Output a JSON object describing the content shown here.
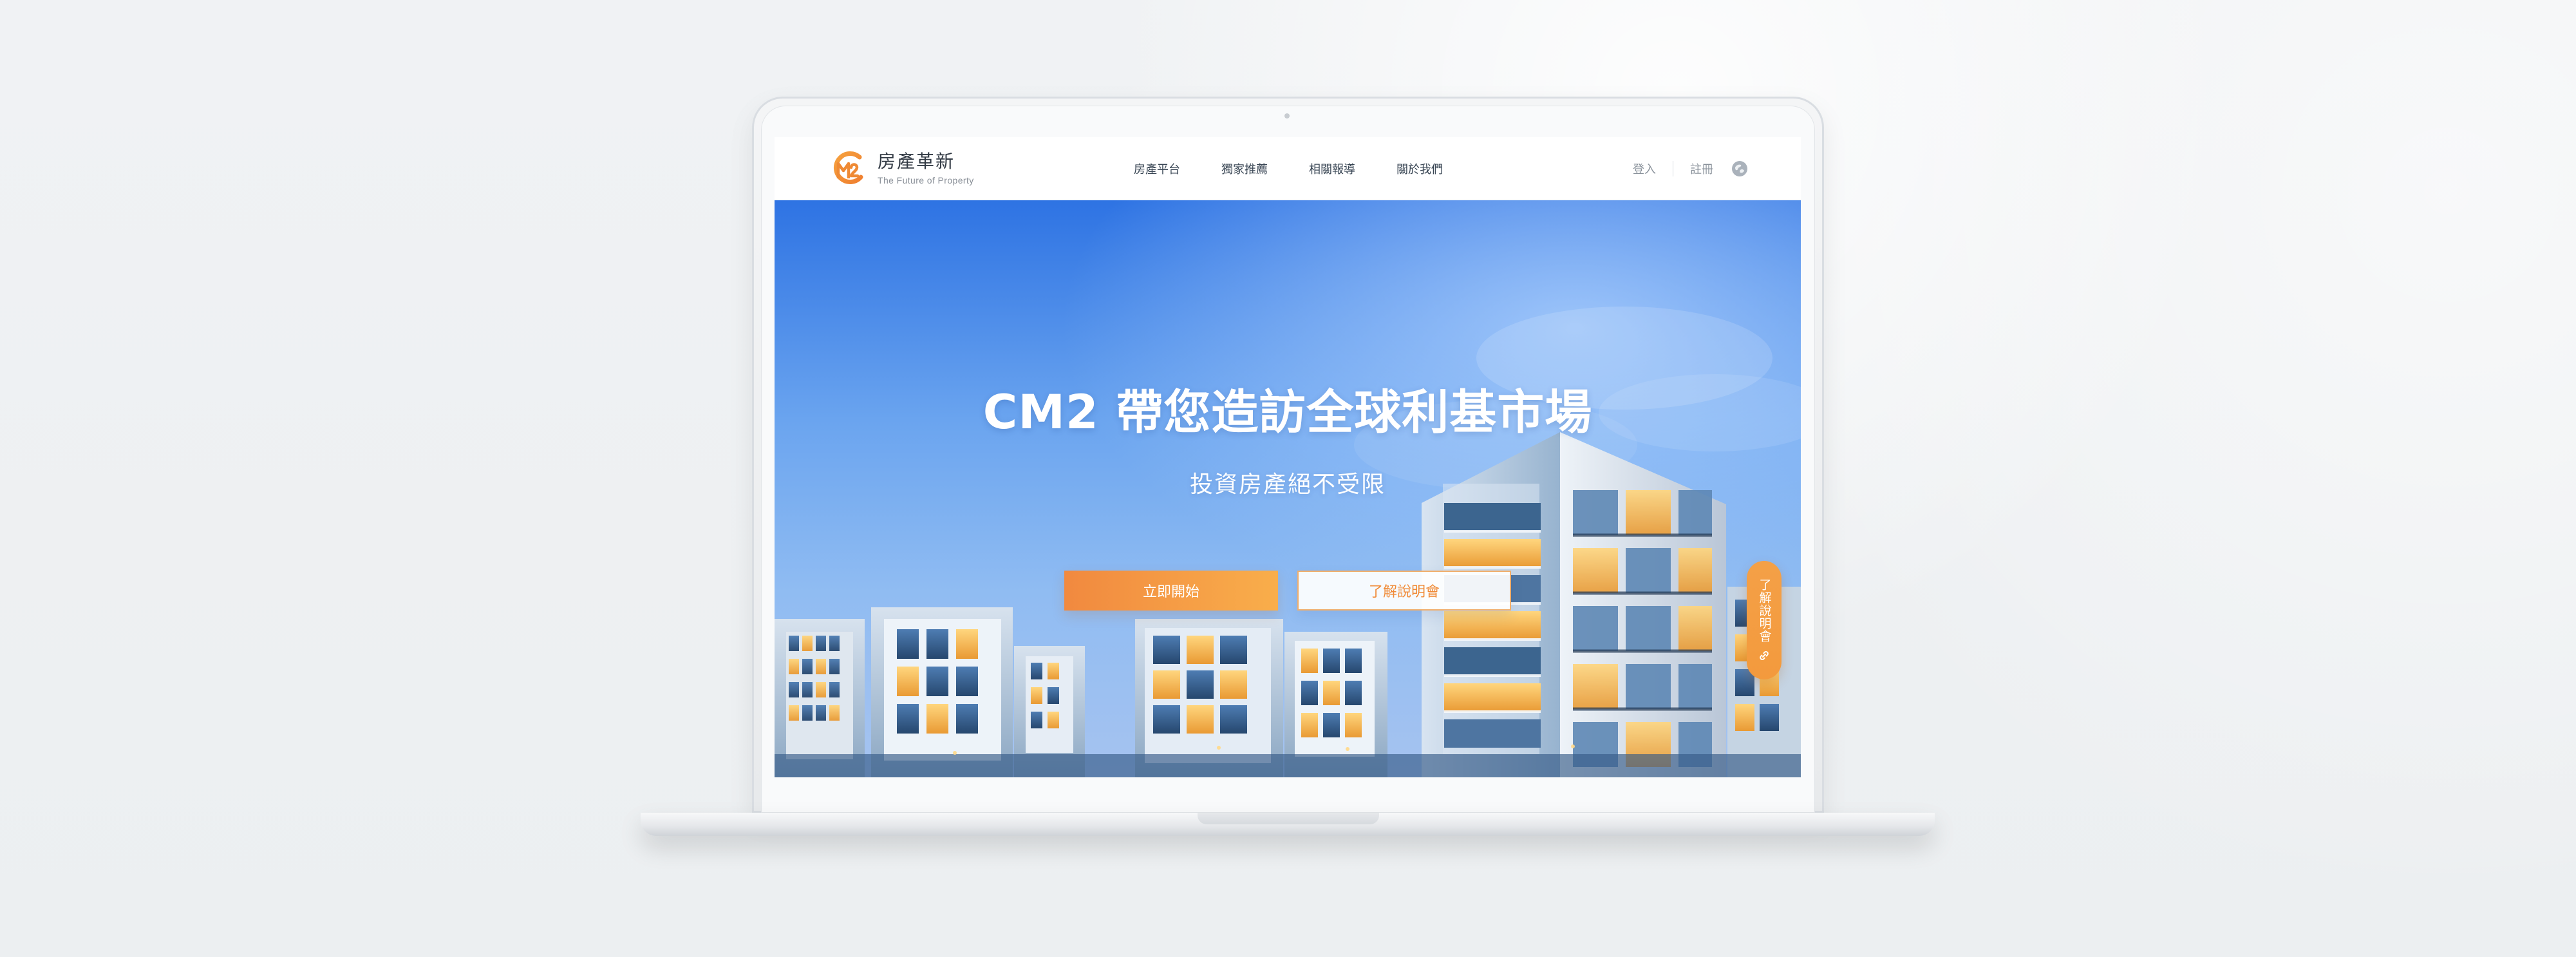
{
  "header": {
    "brand_name": "房產革新",
    "brand_tagline": "The Future of Property",
    "nav_items": [
      "房產平台",
      "獨家推薦",
      "相關報導",
      "關於我們"
    ],
    "login": "登入",
    "register": "註冊"
  },
  "hero": {
    "title": "CM2 帶您造訪全球利基市場",
    "subtitle": "投資房產絕不受限",
    "primary_cta": "立即開始",
    "secondary_cta": "了解說明會"
  },
  "side_tab": {
    "label": "了解說明會"
  },
  "icons": {
    "logo": "cm2-logo",
    "language": "globe-icon",
    "side_tab": "link-icon"
  },
  "colors": {
    "accent": "#f39a3d",
    "brand_orange": "#f28b37",
    "hero_blue": "#3d7ee8",
    "text_dark": "#394654"
  }
}
